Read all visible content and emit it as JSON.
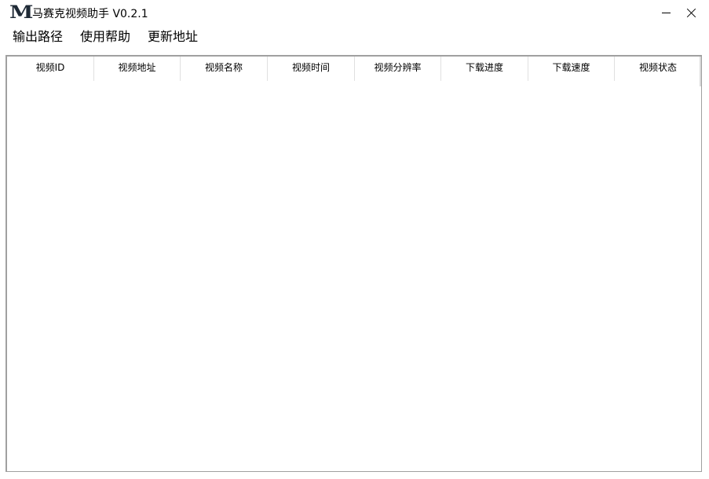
{
  "window": {
    "logo_text": "M",
    "title": "马赛克视频助手 V0.2.1",
    "minimize_icon": "minimize-icon",
    "close_icon": "close-icon"
  },
  "menu": {
    "items": [
      {
        "label": "输出路径"
      },
      {
        "label": "使用帮助"
      },
      {
        "label": "更新地址"
      }
    ]
  },
  "table": {
    "columns": [
      {
        "label": "视频ID"
      },
      {
        "label": "视频地址"
      },
      {
        "label": "视频名称"
      },
      {
        "label": "视频时间"
      },
      {
        "label": "视频分辨率"
      },
      {
        "label": "下载进度"
      },
      {
        "label": "下载速度"
      },
      {
        "label": "视频状态"
      }
    ],
    "rows": []
  }
}
